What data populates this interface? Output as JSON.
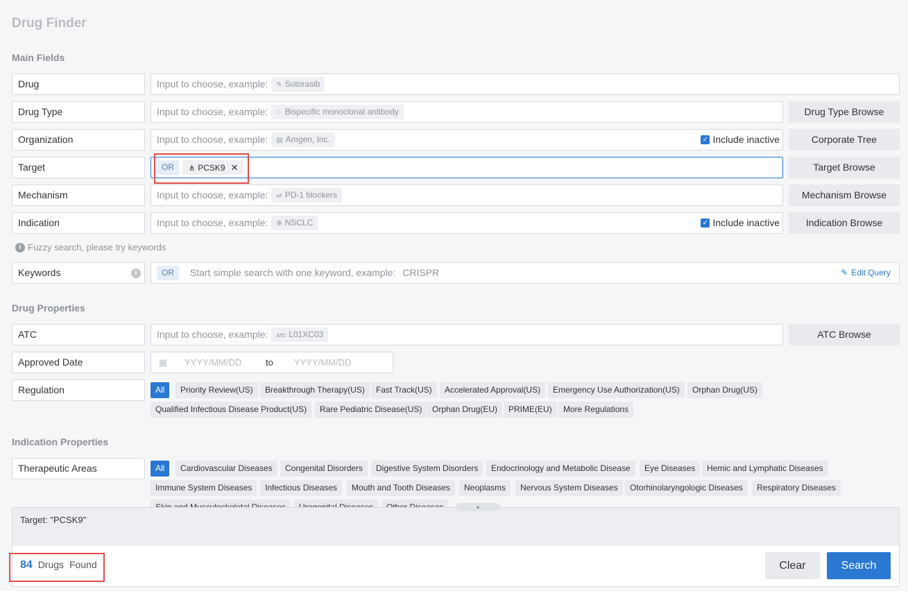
{
  "page_title": "Drug Finder",
  "sections": {
    "main_fields": "Main Fields",
    "drug_properties": "Drug Properties",
    "indication_properties": "Indication Properties"
  },
  "example_prefix": "Input to choose, example:",
  "fields": {
    "drug": {
      "label": "Drug",
      "example": "Sotorasib",
      "icon": "pill-icon"
    },
    "drug_type": {
      "label": "Drug Type",
      "example": "Bispecific monoclonal antibody",
      "icon": "molecule-icon",
      "browse": "Drug Type Browse"
    },
    "organization": {
      "label": "Organization",
      "example": "Amgen, Inc.",
      "icon": "building-icon",
      "include_inactive": "Include inactive",
      "browse": "Corporate Tree"
    },
    "target": {
      "label": "Target",
      "operator": "OR",
      "chip": "PCSK9",
      "chip_icon": "hierarchy-icon",
      "browse": "Target Browse"
    },
    "mechanism": {
      "label": "Mechanism",
      "example": "PD-1 blockers",
      "icon": "arrows-icon",
      "browse": "Mechanism Browse"
    },
    "indication": {
      "label": "Indication",
      "example": "NSCLC",
      "icon": "virus-icon",
      "include_inactive": "Include inactive",
      "browse": "Indication Browse"
    },
    "keywords": {
      "label": "Keywords",
      "operator": "OR",
      "placeholder": "Start simple search with one keyword, example:",
      "example": "CRISPR",
      "edit_query": "Edit Query"
    },
    "atc": {
      "label": "ATC",
      "example": "L01XC03",
      "icon_text": "ATC",
      "browse": "ATC Browse"
    },
    "approved_date": {
      "label": "Approved Date",
      "from_placeholder": "YYYY/MM/DD",
      "to": "to",
      "to_placeholder": "YYYY/MM/DD"
    },
    "regulation": {
      "label": "Regulation"
    },
    "therapeutic_areas": {
      "label": "Therapeutic Areas"
    }
  },
  "fuzzy_hint": "Fuzzy search, please try keywords",
  "regulation_tags": [
    "All",
    "Priority Review(US)",
    "Breakthrough Therapy(US)",
    "Fast Track(US)",
    "Accelerated Approval(US)",
    "Emergency Use Authorization(US)",
    "Orphan Drug(US)",
    "Qualified Infectious Disease Product(US)",
    "Rare Pediatric Disease(US)",
    "Orphan Drug(EU)",
    "PRIME(EU)",
    "More Regulations"
  ],
  "therapeutic_tags": [
    "All",
    "Cardiovascular Diseases",
    "Congenital Disorders",
    "Digestive System Disorders",
    "Endocrinology and Metabolic Disease",
    "Eye Diseases",
    "Hemic and Lymphatic Diseases",
    "Immune System Diseases",
    "Infectious Diseases",
    "Mouth and Tooth Diseases",
    "Neoplasms",
    "Nervous System Diseases",
    "Otorhinolaryngologic Diseases",
    "Respiratory Diseases",
    "Skin and Musculoskeletal Diseases",
    "Urogenital Diseases",
    "Other Diseases"
  ],
  "results": {
    "summary": "Target: \"PCSK9\"",
    "count": "84",
    "drugs_label": "Drugs",
    "found_label": "Found",
    "clear": "Clear",
    "search": "Search"
  },
  "colors": {
    "accent": "#2a78d2",
    "highlight": "#e24b4b"
  }
}
